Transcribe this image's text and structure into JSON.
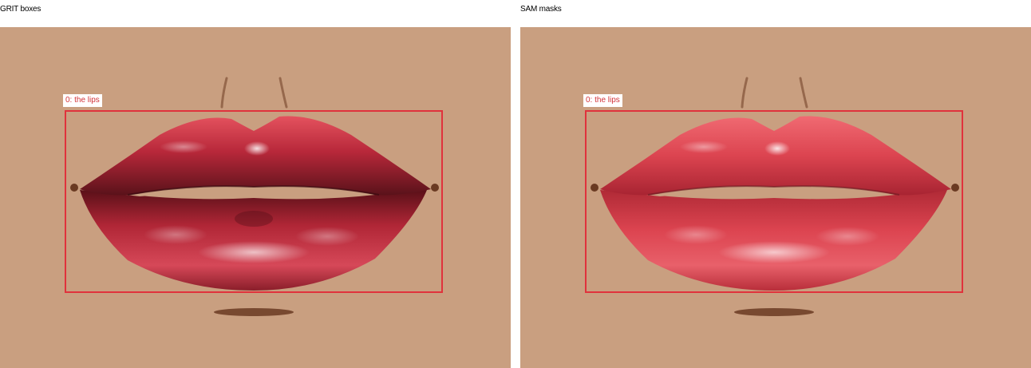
{
  "panels": [
    {
      "title": "GRIT boxes",
      "annotation": {
        "label": "0: the lips",
        "color": "#e0323c"
      },
      "lip_tones": {
        "upper_dark": "#7a1a24",
        "upper_mid": "#b8283a",
        "upper_light": "#e4525e",
        "lower_dark": "#6e1620",
        "lower_mid": "#b82838",
        "lower_light": "#e85c6a"
      }
    },
    {
      "title": "SAM masks",
      "annotation": {
        "label": "0: the lips",
        "color": "#e0323c"
      },
      "lip_tones": {
        "upper_dark": "#b02a36",
        "upper_mid": "#dc4450",
        "upper_light": "#f06a72",
        "lower_dark": "#a82432",
        "lower_mid": "#dc4450",
        "lower_light": "#f27880"
      }
    }
  ],
  "scene": {
    "skin_color": "#c99f80",
    "shadow_color": "#6a3a22"
  }
}
